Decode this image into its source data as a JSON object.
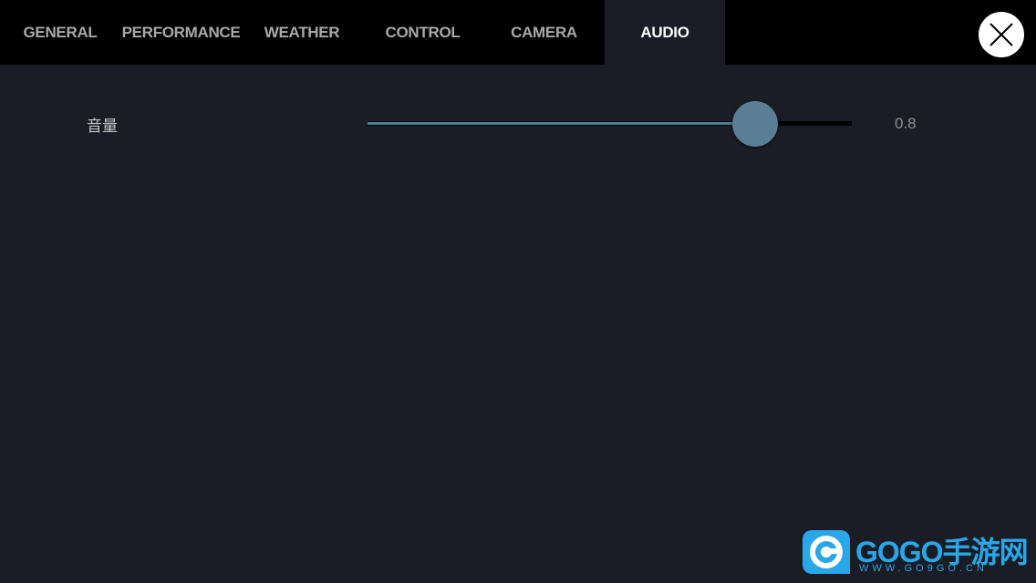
{
  "tabs": [
    {
      "label": "GENERAL"
    },
    {
      "label": "PERFORMANCE"
    },
    {
      "label": "WEATHER"
    },
    {
      "label": "CONTROL"
    },
    {
      "label": "CAMERA"
    },
    {
      "label": "AUDIO",
      "active": true
    }
  ],
  "close_button": {
    "icon": "close-icon"
  },
  "audio": {
    "volume_label": "音量",
    "volume_value": 0.8,
    "volume_value_text": "0.8",
    "slider_colors": {
      "fill": "#4f7e97",
      "track": "#000000",
      "knob": "#5a7e93"
    }
  },
  "watermark": {
    "brand": "GOGO手游网",
    "url": "WWW.GO9GO.CN"
  },
  "colors": {
    "background": "#1a1d25",
    "topbar": "#000000",
    "tab_inactive_text": "#a9a9a9",
    "tab_active_text": "#ffffff",
    "logo_blue": "#2aa7e8"
  }
}
